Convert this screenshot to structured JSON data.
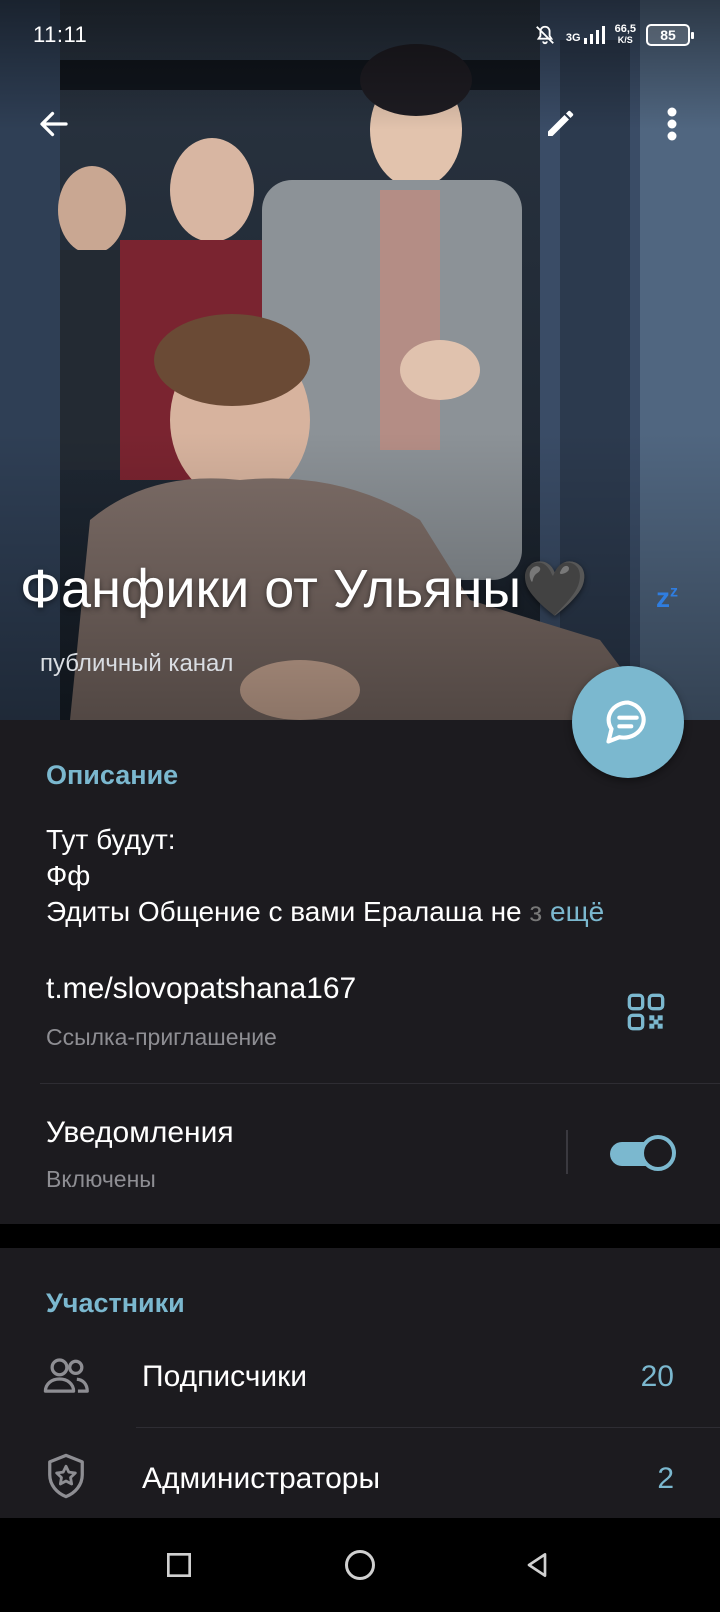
{
  "status_bar": {
    "time": "11:11",
    "network_type": "3G",
    "speed_value": "66,5",
    "speed_unit": "K/S",
    "battery": "85",
    "icons": [
      "mute-bell-icon",
      "signal-icon",
      "battery-icon"
    ]
  },
  "toolbar": {
    "back_icon": "arrow-left-icon",
    "edit_icon": "pencil-icon",
    "menu_icon": "more-vert-icon"
  },
  "channel": {
    "title": "Фанфики от Ульяны🖤",
    "subtitle": "публичный канал",
    "fab_icon": "chat-bubble-icon"
  },
  "info": {
    "description_title": "Описание",
    "description_lines": [
      "Тут будут:",
      "Фф",
      "Эдиты Общение с вами Ералаша не"
    ],
    "description_more": "ещё",
    "link": "t.me/slovopatshana167",
    "link_caption": "Ссылка-приглашение",
    "qr_icon": "qr-code-icon",
    "notifications_label": "Уведомления",
    "notifications_state": "Включены",
    "notifications_on": true
  },
  "members": {
    "title": "Участники",
    "rows": [
      {
        "label": "Подписчики",
        "count": "20",
        "icon": "people-icon"
      },
      {
        "label": "Администраторы",
        "count": "2",
        "icon": "shield-star-icon"
      }
    ]
  },
  "colors": {
    "accent": "#7bb8cf",
    "card_bg": "#1c1b1f",
    "page_bg": "#000000"
  },
  "nav": {
    "icons": [
      "recent-apps-icon",
      "home-icon",
      "back-icon"
    ]
  }
}
